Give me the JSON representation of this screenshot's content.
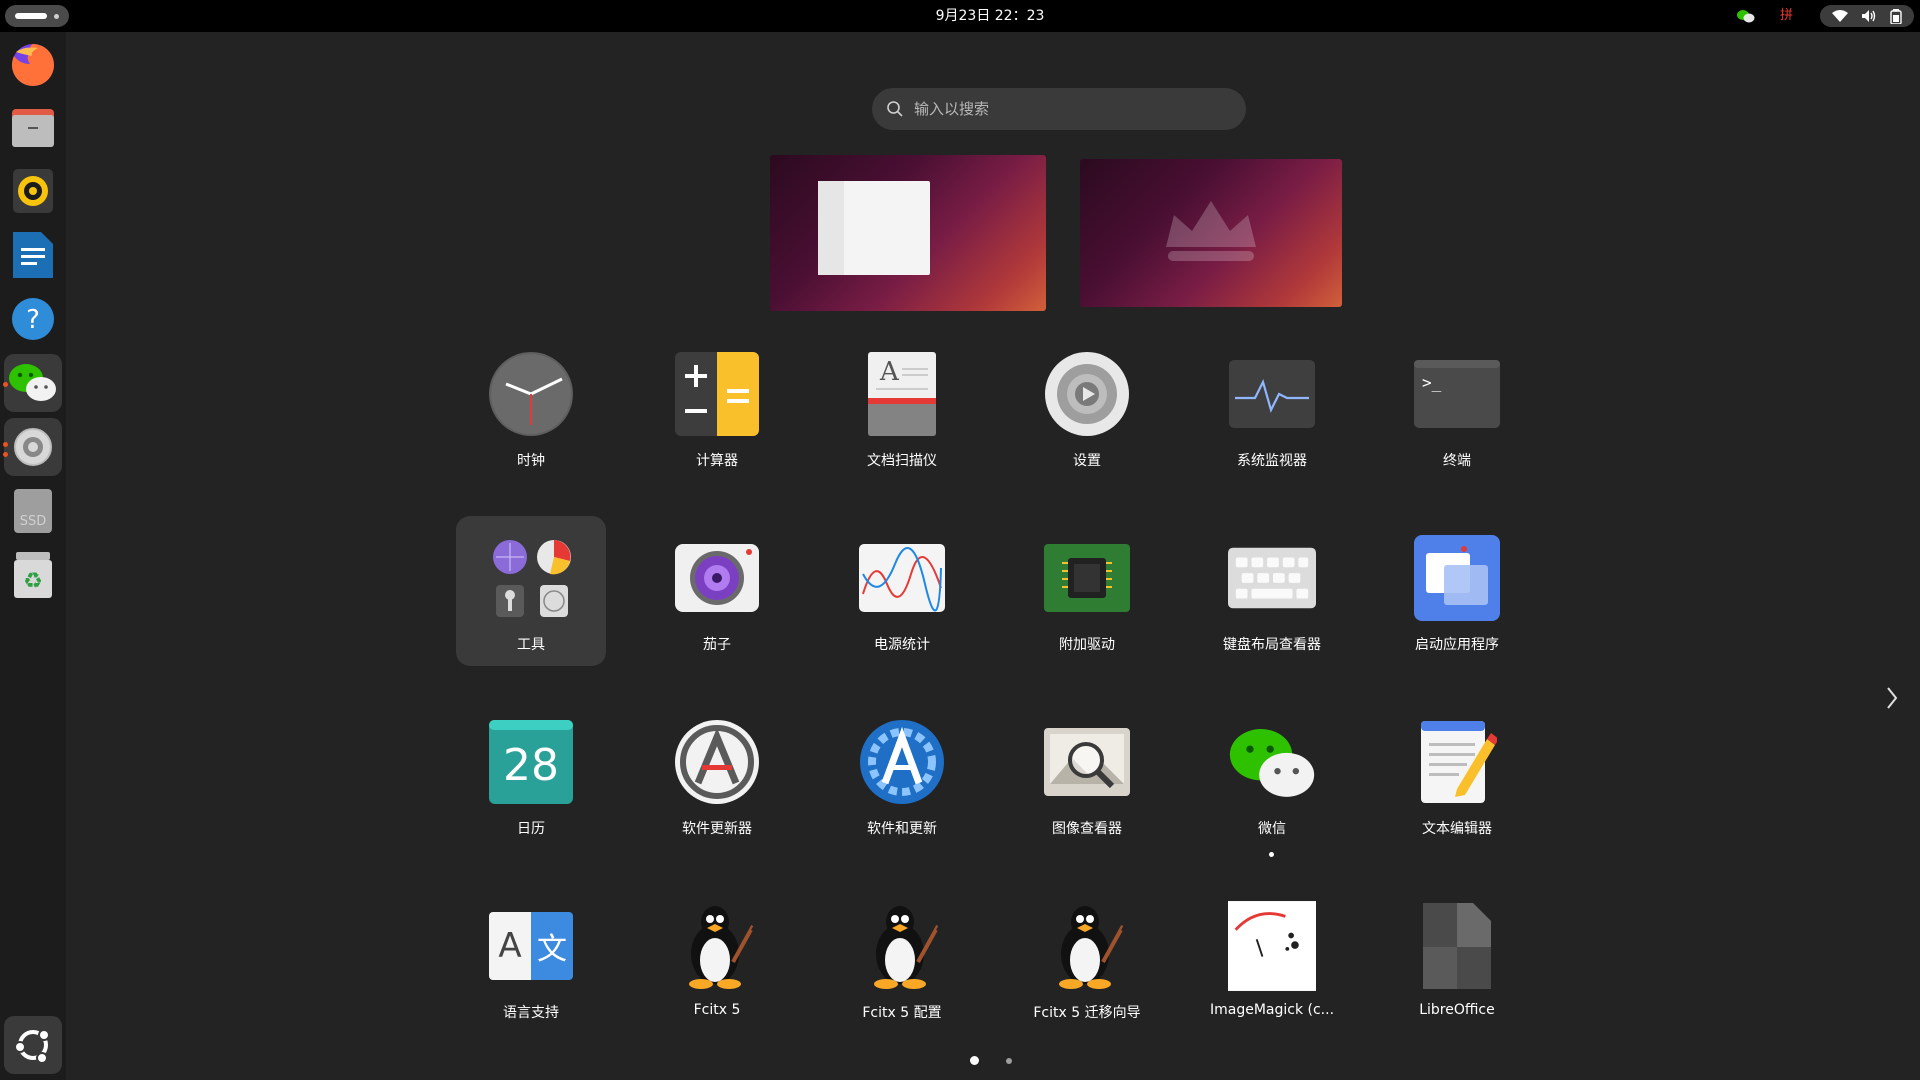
{
  "topbar": {
    "clock": "9月23日  22：23",
    "ime_indicator": "拼"
  },
  "search": {
    "placeholder": "输入以搜索"
  },
  "dock": {
    "items": [
      "firefox",
      "files",
      "rhythmbox",
      "libreoffice-writer",
      "help",
      "wechat",
      "settings",
      "ssd-drive",
      "trash",
      "show-apps"
    ],
    "ssd_label": "SSD"
  },
  "apps": [
    {
      "label": "时钟"
    },
    {
      "label": "计算器"
    },
    {
      "label": "文档扫描仪"
    },
    {
      "label": "设置"
    },
    {
      "label": "系统监视器"
    },
    {
      "label": "终端"
    },
    {
      "label": "工具"
    },
    {
      "label": "茄子"
    },
    {
      "label": "电源统计"
    },
    {
      "label": "附加驱动"
    },
    {
      "label": "键盘布局查看器"
    },
    {
      "label": "启动应用程序"
    },
    {
      "label": "日历",
      "icon_text": "28"
    },
    {
      "label": "软件更新器"
    },
    {
      "label": "软件和更新"
    },
    {
      "label": "图像查看器"
    },
    {
      "label": "微信"
    },
    {
      "label": "文本编辑器"
    },
    {
      "label": "语言支持",
      "icon_text_a": "A",
      "icon_text_b": "文"
    },
    {
      "label": "Fcitx 5"
    },
    {
      "label": "Fcitx 5 配置"
    },
    {
      "label": "Fcitx 5 迁移向导"
    },
    {
      "label": "ImageMagick (c..."
    },
    {
      "label": "LibreOffice"
    }
  ],
  "pager": {
    "current": 1,
    "total": 2
  },
  "colors": {
    "ubuntu_orange": "#e95420",
    "workspace_purple": "#4a0f33",
    "calendar_teal": "#2aa198",
    "calculator_yellow": "#f9c02b"
  }
}
